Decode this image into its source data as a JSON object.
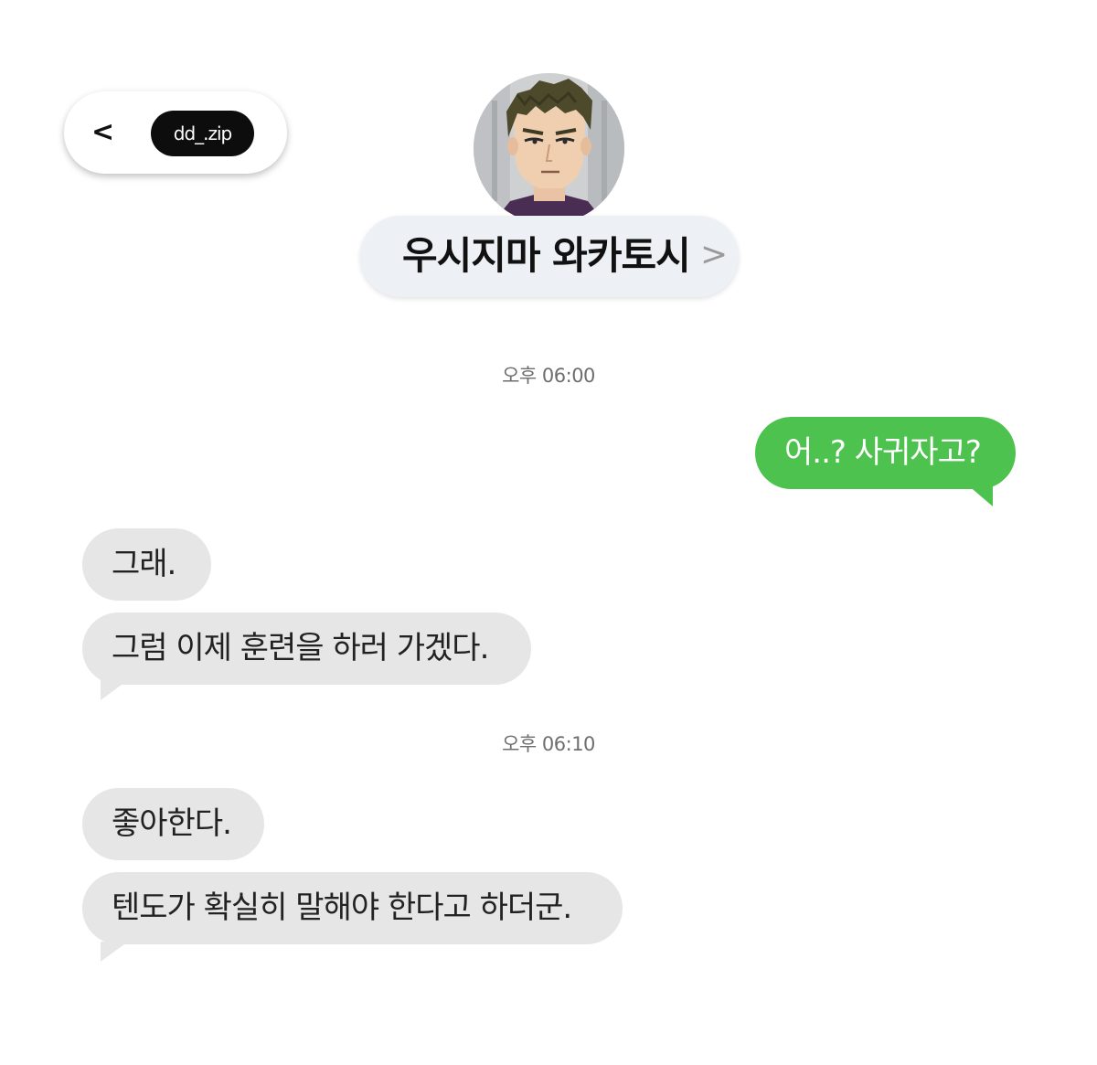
{
  "header": {
    "back_label": "<",
    "handle": "dd_.zip",
    "contact_name": "우시지마 와카토시",
    "chevron": ">"
  },
  "timestamps": [
    "오후 06:00",
    "오후 06:10"
  ],
  "messages": [
    {
      "direction": "out",
      "text": "어..? 사귀자고?"
    },
    {
      "direction": "in",
      "text": "그래."
    },
    {
      "direction": "in",
      "text": "그럼 이제 훈련을 하러 가겠다."
    },
    {
      "direction": "in",
      "text": "좋아한다."
    },
    {
      "direction": "in",
      "text": "텐도가 확실히 말해야 한다고 하더군."
    }
  ],
  "colors": {
    "outgoing_bubble": "#4ec24f",
    "incoming_bubble": "#e6e6e6",
    "name_pill": "#edf0f5",
    "handle_chip": "#0d0d0d"
  },
  "icons": {
    "back": "chevron-left-icon",
    "name_more": "chevron-right-icon",
    "avatar": "avatar-icon"
  }
}
